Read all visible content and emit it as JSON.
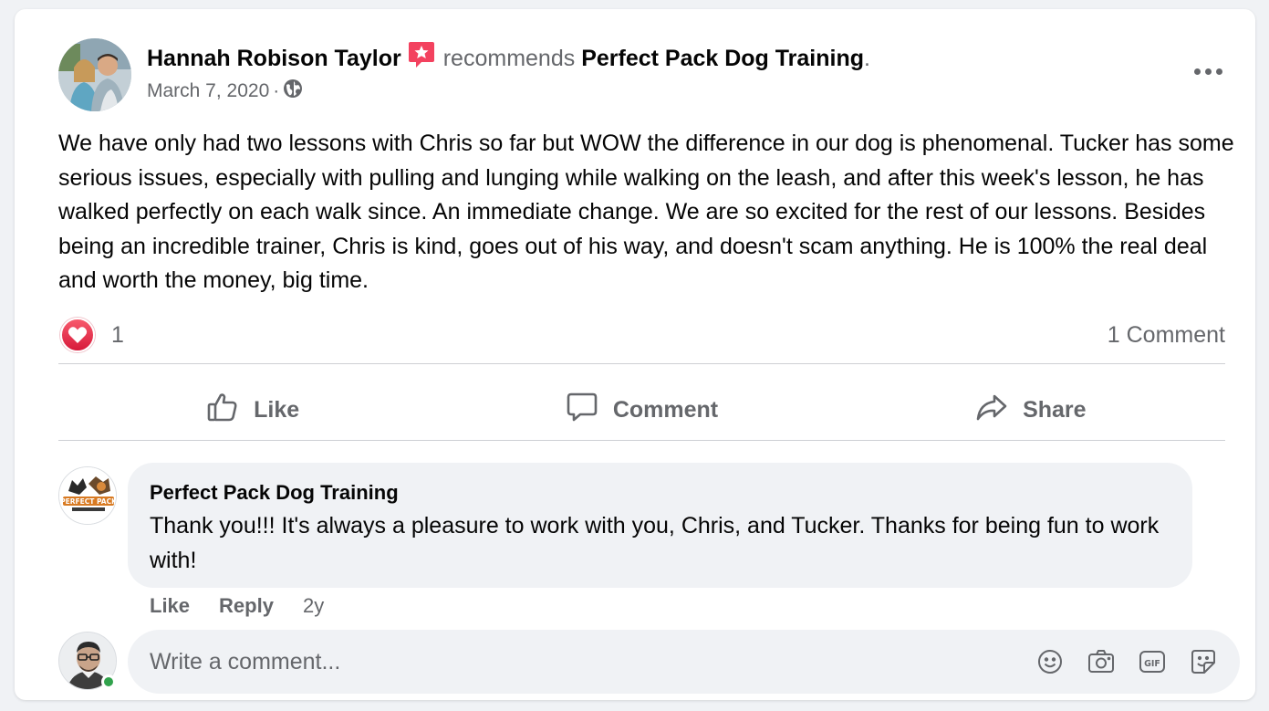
{
  "post": {
    "author": "Hannah Robison Taylor",
    "verb": "recommends",
    "page": "Perfect Pack Dog Training",
    "punct": ".",
    "date": "March 7, 2020",
    "date_sep": "·",
    "privacy_icon": "globe-icon",
    "text": "We have only had two lessons with Chris so far but WOW the difference in our dog is phenomenal. Tucker has some serious issues, especially with pulling and lunging while walking on the leash, and after this week's lesson, he has walked perfectly on each walk since. An immediate change. We are so excited for the rest of our lessons. Besides being an incredible trainer, Chris is kind, goes out of his way, and doesn't scam anything. He is 100% the real deal and worth the money, big time."
  },
  "stats": {
    "reaction_icon": "love-reaction-icon",
    "reaction_count": "1",
    "comments_label": "1 Comment"
  },
  "actions": {
    "like": "Like",
    "comment": "Comment",
    "share": "Share"
  },
  "comment": {
    "author": "Perfect Pack Dog Training",
    "text": "Thank you!!! It's always a pleasure to work with you, Chris, and Tucker. Thanks for being fun to work with!",
    "like": "Like",
    "reply": "Reply",
    "age": "2y"
  },
  "composer": {
    "placeholder": "Write a comment..."
  },
  "colors": {
    "text": "#050505",
    "muted": "#65676b",
    "badge": "#f3425f",
    "online": "#31a24c",
    "bubble": "#f0f2f5"
  }
}
